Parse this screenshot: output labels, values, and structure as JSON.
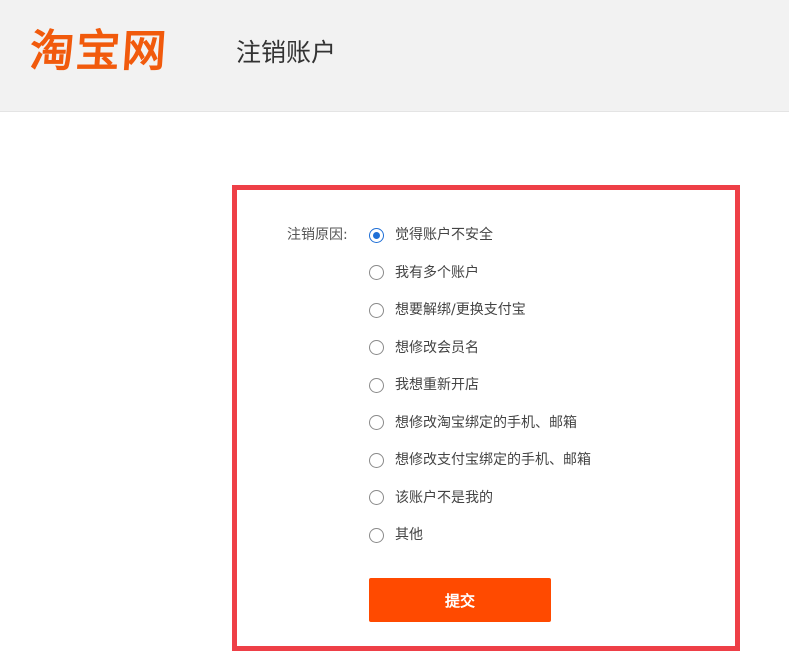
{
  "header": {
    "logo_text": "淘宝网",
    "title": "注销账户"
  },
  "form": {
    "reason_label": "注销原因:",
    "options": [
      {
        "label": "觉得账户不安全",
        "checked": true
      },
      {
        "label": "我有多个账户",
        "checked": false
      },
      {
        "label": "想要解绑/更换支付宝",
        "checked": false
      },
      {
        "label": "想修改会员名",
        "checked": false
      },
      {
        "label": "我想重新开店",
        "checked": false
      },
      {
        "label": "想修改淘宝绑定的手机、邮箱",
        "checked": false
      },
      {
        "label": "想修改支付宝绑定的手机、邮箱",
        "checked": false
      },
      {
        "label": "该账户不是我的",
        "checked": false
      },
      {
        "label": "其他",
        "checked": false
      }
    ],
    "submit_label": "提交"
  },
  "colors": {
    "brand": "#f15a0c",
    "panel_border": "#ee3f47",
    "submit": "#ff4a00",
    "radio_selected": "#1f6fd6"
  }
}
